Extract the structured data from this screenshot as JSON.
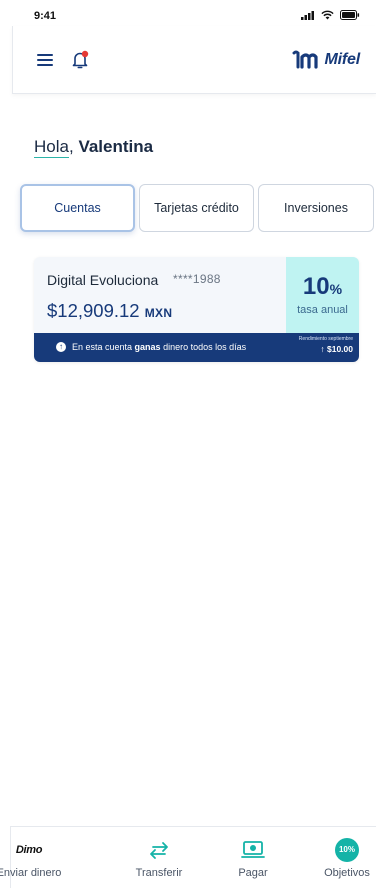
{
  "status_bar": {
    "time": "9:41"
  },
  "header": {
    "brand": "Mifel"
  },
  "greeting": {
    "hello": "Hola",
    "comma": ",",
    "name": "Valentina"
  },
  "tabs": [
    {
      "label": "Cuentas",
      "active": true
    },
    {
      "label": "Tarjetas crédito",
      "active": false
    },
    {
      "label": "Inversiones",
      "active": false
    }
  ],
  "account_card": {
    "name": "Digital Evoluciona",
    "masked_number": "****1988",
    "balance": "$12,909.12",
    "currency": "MXN",
    "rate_value": "10",
    "rate_unit": "%",
    "rate_label": "tasa anual",
    "footer_text_before": "En esta cuenta ",
    "footer_text_bold": "ganas",
    "footer_text_after": " dinero todos los días",
    "yield_label": "Rendimiento septiembre",
    "yield_value": "↑ $10.00"
  },
  "bottom_nav": [
    {
      "label": "Enviar dinero",
      "icon": "dimo-logo-icon",
      "icon_text": "Dimo"
    },
    {
      "label": "Transferir",
      "icon": "transfer-arrows-icon"
    },
    {
      "label": "Pagar",
      "icon": "cash-icon"
    },
    {
      "label": "Objetivos",
      "icon": "objetivos-badge-icon",
      "icon_text": "10%"
    }
  ],
  "colors": {
    "brand_blue": "#173a7a",
    "accent_teal": "#14b3a7",
    "rate_bg": "#bff3f2",
    "notification_dot": "#e53935"
  }
}
